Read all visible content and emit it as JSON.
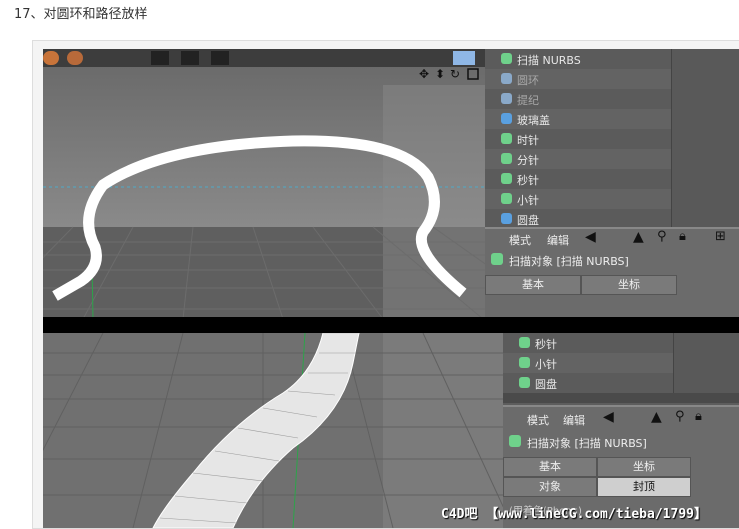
{
  "heading": "17、对圆环和路径放样",
  "top": {
    "tree": [
      {
        "label": "扫描 NURBS",
        "dim": false,
        "icon_color": "#6fd18b"
      },
      {
        "label": "圆环",
        "dim": true,
        "icon_color": "#8aa9c9"
      },
      {
        "label": "提纪",
        "dim": true,
        "icon_color": "#8aa9c9"
      },
      {
        "label": "玻璃盖",
        "dim": false,
        "icon_color": "#5aa0e0"
      },
      {
        "label": "时针",
        "dim": false,
        "icon_color": "#6fd18b"
      },
      {
        "label": "分针",
        "dim": false,
        "icon_color": "#6fd18b"
      },
      {
        "label": "秒针",
        "dim": false,
        "icon_color": "#6fd18b"
      },
      {
        "label": "小针",
        "dim": false,
        "icon_color": "#6fd18b"
      },
      {
        "label": "圆盘",
        "dim": false,
        "icon_color": "#5aa0e0"
      }
    ],
    "menu": {
      "mode": "模式",
      "edit": "编辑"
    },
    "object_title": "扫描对象 [扫描 NURBS]",
    "tabs": {
      "basic": "基本",
      "coord": "坐标"
    }
  },
  "bottom": {
    "tree": [
      {
        "label": "秒针"
      },
      {
        "label": "小针"
      },
      {
        "label": "圆盘"
      }
    ],
    "menu": {
      "mode": "模式",
      "edit": "编辑"
    },
    "object_title": "扫描对象 [扫描 NURBS]",
    "tabs": {
      "basic": "基本",
      "coord": "坐标",
      "object": "对象",
      "cap": "封顶"
    },
    "partial": "(用着色(Phong)"
  },
  "watermark": "C4D吧 【www.lineCG.com/tieba/1799】"
}
